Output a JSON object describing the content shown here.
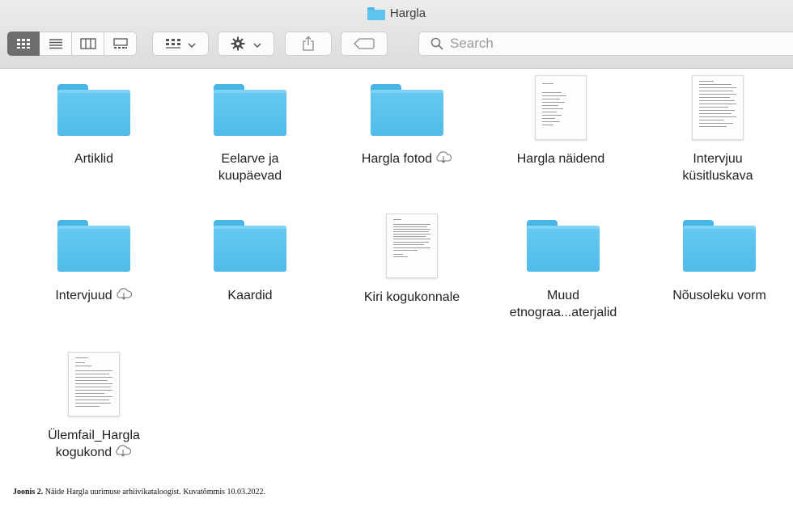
{
  "window": {
    "title": "Hargla",
    "folder_icon": "folder-icon",
    "accent_color": "#5ec3ee"
  },
  "toolbar": {
    "view_modes": [
      {
        "name": "icon-view-icon",
        "active": true
      },
      {
        "name": "list-view-icon",
        "active": false
      },
      {
        "name": "column-view-icon",
        "active": false
      },
      {
        "name": "gallery-view-icon",
        "active": false
      }
    ],
    "group_icon": "group-by-icon",
    "action_icon": "gear-icon",
    "share_icon": "share-icon",
    "tags_icon": "tag-icon",
    "search_icon": "search-icon",
    "search_placeholder": "Search"
  },
  "items": [
    {
      "label": "Artiklid",
      "type": "folder",
      "cloud": false
    },
    {
      "label": "Eelarve ja\nkuupäevad",
      "type": "folder",
      "cloud": false
    },
    {
      "label": "Hargla fotod",
      "type": "folder",
      "cloud": true
    },
    {
      "label": "Hargla näidend",
      "type": "document",
      "cloud": false
    },
    {
      "label": "Intervjuu\nküsitluskava",
      "type": "document",
      "cloud": false
    },
    {
      "label": "Intervjuud",
      "type": "folder",
      "cloud": true
    },
    {
      "label": "Kaardid",
      "type": "folder",
      "cloud": false
    },
    {
      "label": "Kiri kogukonnale",
      "type": "document",
      "cloud": false
    },
    {
      "label": "Muud\netnograa...aterjalid",
      "type": "folder",
      "cloud": false
    },
    {
      "label": "Nõusoleku vorm",
      "type": "folder",
      "cloud": false
    },
    {
      "label": "Ülemfail_Hargla\nkogukond",
      "type": "document",
      "cloud": true
    }
  ],
  "caption": {
    "label": "Joonis 2.",
    "text": " Näide Hargla uurimuse arhiivikataloogist. Kuvatõmmis 10.03.2022."
  }
}
